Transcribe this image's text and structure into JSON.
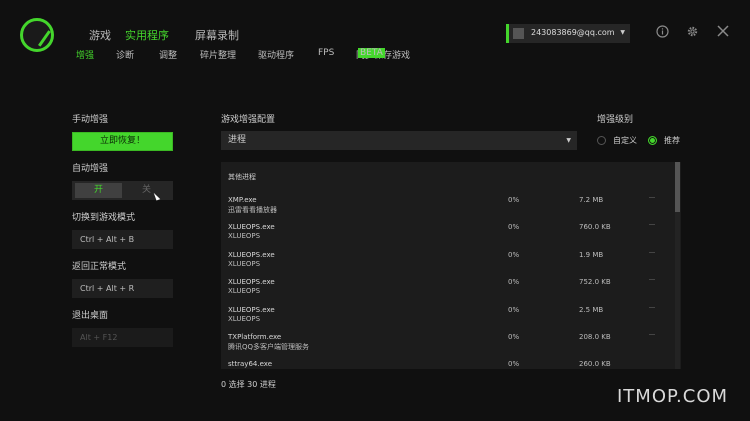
{
  "nav": {
    "tabs": [
      "游戏",
      "实用程序",
      "屏幕录制"
    ],
    "active_tab": 1,
    "subtabs": [
      "增强",
      "诊断",
      "调整",
      "碎片整理",
      "驱动程序",
      "FPS",
      "同步保存游戏"
    ],
    "active_subtab": 0,
    "beta_label": "BETA"
  },
  "account": {
    "email": "243083869@qq.com"
  },
  "icons": {
    "info": "info-icon",
    "settings": "gear-icon",
    "close": "close-icon"
  },
  "left": {
    "manual_title": "手动增强",
    "manual_button": "立即恢复！",
    "auto_title": "自动增强",
    "toggle_on": "开",
    "toggle_off": "关",
    "switch_game_title": "切换到游戏模式",
    "switch_game_key": "Ctrl + Alt + B",
    "return_normal_title": "返回正常模式",
    "return_normal_key": "Ctrl + Alt + R",
    "exit_desktop_title": "退出桌面",
    "exit_desktop_key": "Alt + F12"
  },
  "config": {
    "title": "游戏增强配置",
    "select_value": "进程",
    "table_header": "其他进程",
    "rows": [
      {
        "name": "XMP.exe",
        "desc": "迅雷看看播放器",
        "cpu": "0%",
        "mem": "7.2 MB"
      },
      {
        "name": "XLUEOPS.exe",
        "desc": "XLUEOPS",
        "cpu": "0%",
        "mem": "760.0 KB"
      },
      {
        "name": "XLUEOPS.exe",
        "desc": "XLUEOPS",
        "cpu": "0%",
        "mem": "1.9 MB"
      },
      {
        "name": "XLUEOPS.exe",
        "desc": "XLUEOPS",
        "cpu": "0%",
        "mem": "752.0 KB"
      },
      {
        "name": "XLUEOPS.exe",
        "desc": "XLUEOPS",
        "cpu": "0%",
        "mem": "2.5 MB"
      },
      {
        "name": "TXPlatform.exe",
        "desc": "腾讯QQ多客户端管理服务",
        "cpu": "0%",
        "mem": "208.0 KB"
      },
      {
        "name": "sttray64.exe",
        "desc": "",
        "cpu": "0%",
        "mem": "260.0 KB"
      }
    ],
    "footer": "0 选择 30 进程"
  },
  "level": {
    "title": "增强级别",
    "options": [
      "自定义",
      "推荐"
    ],
    "selected": 1
  },
  "watermark": "ITMOP.COM"
}
